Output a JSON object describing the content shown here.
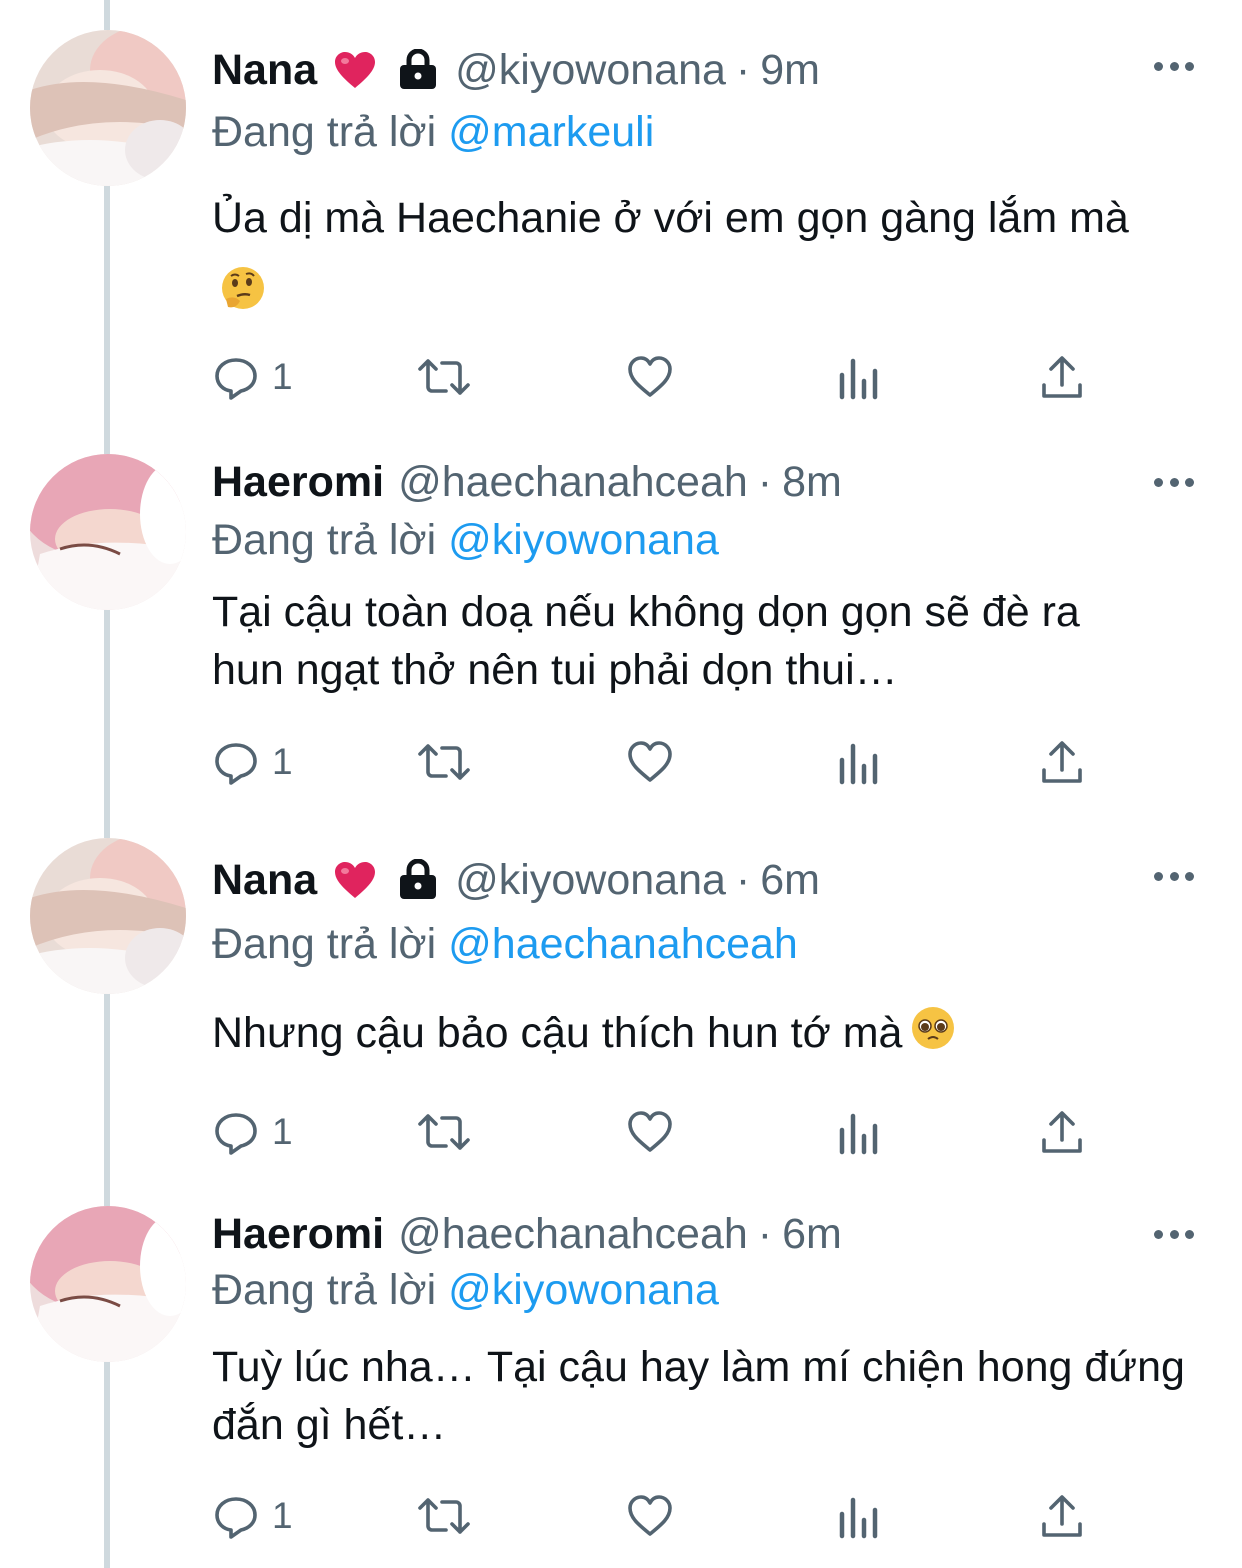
{
  "tweets": [
    {
      "display_name": "Nana",
      "handle": "@kiyowonana",
      "separator": "·",
      "time": "9m",
      "replying_prefix": "Đang trả lời",
      "replying_to": "@markeuli",
      "text": "Ủa dị mà Haechanie ở với em gọn gàng lắm mà",
      "text_emoji": "thinking-face",
      "reply_count": "1",
      "locked": true,
      "heart": true
    },
    {
      "display_name": "Haeromi",
      "handle": "@haechanahceah",
      "separator": "·",
      "time": "8m",
      "replying_prefix": "Đang trả lời",
      "replying_to": "@kiyowonana",
      "text": "Tại cậu toàn doạ nếu không dọn gọn sẽ đè ra hun ngạt thở nên tui phải dọn thui…",
      "reply_count": "1",
      "locked": false,
      "heart": false
    },
    {
      "display_name": "Nana",
      "handle": "@kiyowonana",
      "separator": "·",
      "time": "6m",
      "replying_prefix": "Đang trả lời",
      "replying_to": "@haechanahceah",
      "text": "Nhưng cậu bảo cậu thích hun tớ mà",
      "text_emoji": "pleading-face",
      "reply_count": "1",
      "locked": true,
      "heart": true
    },
    {
      "display_name": "Haeromi",
      "handle": "@haechanahceah",
      "separator": "·",
      "time": "6m",
      "replying_prefix": "Đang trả lời",
      "replying_to": "@kiyowonana",
      "text": "Tuỳ lúc nha… Tại cậu hay làm mí chiện hong đứng đắn gì hết…",
      "reply_count": "1",
      "locked": false,
      "heart": false
    }
  ],
  "icons": {
    "reply": "reply-icon",
    "retweet": "retweet-icon",
    "like": "like-icon",
    "analytics": "analytics-icon",
    "share": "share-icon",
    "more": "more-icon",
    "lock": "lock-icon",
    "heart_emoji": "red-heart-emoji"
  },
  "colors": {
    "text_primary": "#0f1419",
    "text_secondary": "#536471",
    "link": "#1d9bf0",
    "thread_line": "#cfd9de",
    "heart": "#e0245e"
  }
}
